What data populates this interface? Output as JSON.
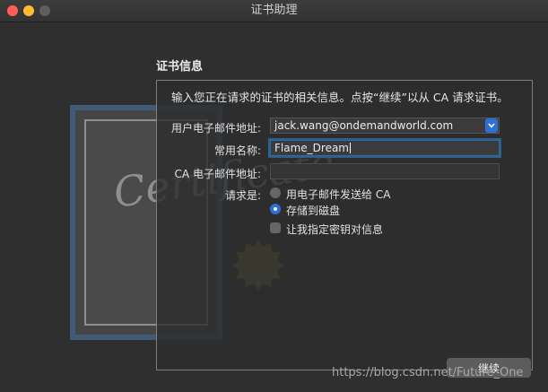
{
  "window": {
    "title": "证书助理"
  },
  "section": {
    "title": "证书信息"
  },
  "intro": "输入您正在请求的证书的相关信息。点按“继续”以从 CA 请求证书。",
  "certificate_decoration": {
    "script_text": "Certificate"
  },
  "form": {
    "email": {
      "label": "用户电子邮件地址:",
      "value": "jack.wang@ondemandworld.com"
    },
    "common_name": {
      "label": "常用名称:",
      "value": "Flame_Dream"
    },
    "ca_email": {
      "label": "CA 电子邮件地址:",
      "value": ""
    },
    "request_label": "请求是:",
    "options": [
      {
        "label": "用电子邮件发送给 CA",
        "selected": false
      },
      {
        "label": "存储到磁盘",
        "selected": true
      }
    ],
    "checkbox": {
      "label": "让我指定密钥对信息",
      "checked": false
    }
  },
  "buttons": {
    "continue": "继续"
  },
  "watermark": "https://blog.csdn.net/Future_One",
  "colors": {
    "accent": "#2d6fd6",
    "close": "#ff5f57",
    "minimize": "#febc2e"
  }
}
